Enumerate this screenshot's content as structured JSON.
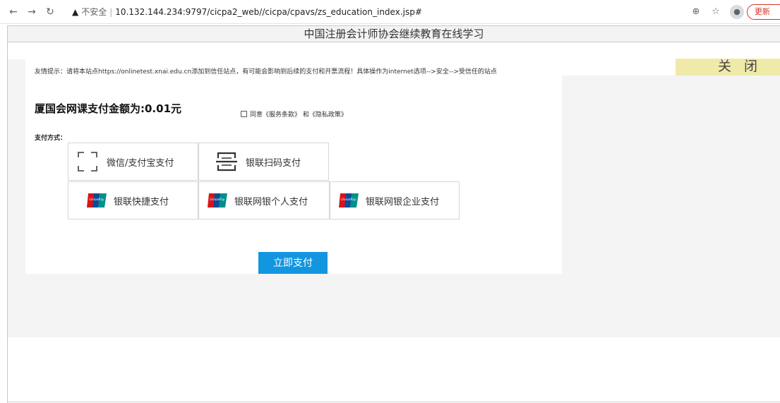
{
  "browser": {
    "security_label": "不安全",
    "url": "10.132.144.234:9797/cicpa2_web//cicpa/cpavs/zs_education_index.jsp#",
    "update_label": "更新"
  },
  "page": {
    "title": "中国注册会计师协会继续教育在线学习",
    "close_label": "关闭",
    "tip": "友情提示：请将本站点https://onlinetest.xnai.edu.cn添加到信任站点，有可能会影响到后续的支付和开票流程！具体操作为internet选项-->安全-->受信任的站点",
    "amount": "厦国会网课支付金额为:0.01元",
    "agree_text": "同意《服务条款》 和《隐私政策》",
    "payment_label": "支付方式：",
    "payment_options": [
      {
        "label": "微信/支付宝支付",
        "icon": "scan-qr-icon"
      },
      {
        "label": "银联扫码支付",
        "icon": "scan-barcode-icon"
      },
      {
        "label": "银联快捷支付",
        "icon": "unionpay-icon"
      },
      {
        "label": "银联网银个人支付",
        "icon": "unionpay-icon"
      },
      {
        "label": "银联网银企业支付",
        "icon": "unionpay-icon"
      }
    ],
    "pay_button": "立即支付"
  },
  "colors": {
    "pay_button": "#1396e0",
    "close_bg": "#f0eaa8",
    "unionpay_red": "#d7141a",
    "unionpay_blue": "#0e4c96",
    "unionpay_teal": "#00908c"
  }
}
